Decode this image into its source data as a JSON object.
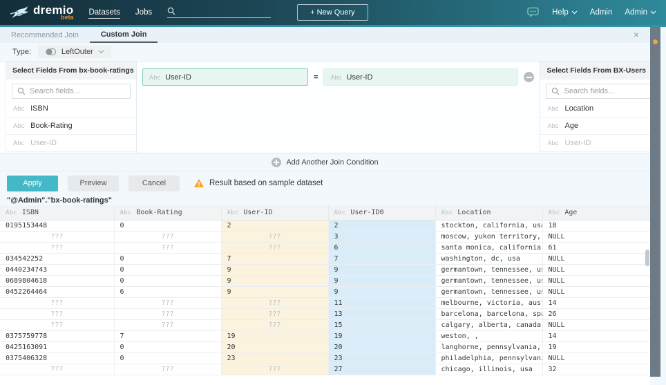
{
  "navbar": {
    "logo_text": "dremio",
    "beta_label": "beta",
    "nav_items": [
      {
        "label": "Datasets",
        "active": true
      },
      {
        "label": "Jobs",
        "active": false
      }
    ],
    "search_placeholder": "",
    "new_query_label": "+ New Query",
    "help_label": "Help",
    "admin_label": "Admin",
    "admin_menu_label": "Admin"
  },
  "tabs": [
    {
      "label": "Recommended Join",
      "active": false
    },
    {
      "label": "Custom Join",
      "active": true
    }
  ],
  "join": {
    "type_label": "Type:",
    "type_value": "LeftOuter",
    "left_panel": {
      "title": "Select Fields From bx-book-ratings (Current)",
      "search_placeholder": "Search fields...",
      "fields": [
        {
          "type": "Abc",
          "name": "ISBN",
          "disabled": false
        },
        {
          "type": "Abc",
          "name": "Book-Rating",
          "disabled": false
        },
        {
          "type": "Abc",
          "name": "User-ID",
          "disabled": true
        }
      ]
    },
    "right_panel": {
      "title": "Select Fields From BX-Users",
      "search_placeholder": "Search fields...",
      "fields": [
        {
          "type": "Abc",
          "name": "Location",
          "disabled": false
        },
        {
          "type": "Abc",
          "name": "Age",
          "disabled": false
        },
        {
          "type": "Abc",
          "name": "User-ID",
          "disabled": true
        }
      ]
    },
    "condition": {
      "left_type": "Abc",
      "left_field": "User-ID",
      "operator": "=",
      "right_type": "Abc",
      "right_field": "User-ID"
    },
    "add_condition_label": "Add Another Join Condition"
  },
  "actions": {
    "apply_label": "Apply",
    "preview_label": "Preview",
    "cancel_label": "Cancel",
    "warning_text": "Result based on sample dataset"
  },
  "table": {
    "title": "\"@Admin\".\"bx-book-ratings\"",
    "unknown_marker": "???",
    "columns": [
      {
        "type": "Abc",
        "name": "ISBN"
      },
      {
        "type": "Abc",
        "name": "Book-Rating"
      },
      {
        "type": "Abc",
        "name": "User-ID"
      },
      {
        "type": "Abc",
        "name": "User-ID0"
      },
      {
        "type": "Abc",
        "name": "Location"
      },
      {
        "type": "Abc",
        "name": "Age"
      }
    ],
    "rows": [
      [
        "0195153448",
        "0",
        "2",
        "2",
        "stockton, california, usa",
        "18"
      ],
      [
        "???",
        "???",
        "???",
        "3",
        "moscow, yukon territory, russia",
        "NULL"
      ],
      [
        "???",
        "???",
        "???",
        "6",
        "santa monica, california, usa",
        "61"
      ],
      [
        "034542252",
        "0",
        "7",
        "7",
        "washington, dc, usa",
        "NULL"
      ],
      [
        "0440234743",
        "0",
        "9",
        "9",
        "germantown, tennessee, usa",
        "NULL"
      ],
      [
        "0689804618",
        "0",
        "9",
        "9",
        "germantown, tennessee, usa",
        "NULL"
      ],
      [
        "0452264464",
        "6",
        "9",
        "9",
        "germantown, tennessee, usa",
        "NULL"
      ],
      [
        "???",
        "???",
        "???",
        "11",
        "melbourne, victoria, australia",
        "14"
      ],
      [
        "???",
        "???",
        "???",
        "13",
        "barcelona, barcelona, spain",
        "26"
      ],
      [
        "???",
        "???",
        "???",
        "15",
        "calgary, alberta, canada",
        "NULL"
      ],
      [
        "0375759778",
        "7",
        "19",
        "19",
        "weston, ,",
        "14"
      ],
      [
        "0425163091",
        "0",
        "20",
        "20",
        "langhorne, pennsylvania, usa",
        "19"
      ],
      [
        "0375406328",
        "0",
        "23",
        "23",
        "philadelphia, pennsylvania, usa",
        "NULL"
      ],
      [
        "???",
        "???",
        "???",
        "27",
        "chicago, illinois, usa",
        "32"
      ]
    ]
  },
  "colors": {
    "accent_teal": "#45b8c7",
    "brand_orange": "#e8922e",
    "navbar_dark": "#142e3b",
    "navbar_teal": "#2f8a9b",
    "chip_bg": "#e7f6f1",
    "chip_border": "#7fcfbe",
    "highlight_left_col": "#fbf3de",
    "highlight_right_col": "#d9ecf8",
    "warning_orange": "#f5a623",
    "rail_gray": "#6c7b86",
    "rail_dot_orange": "#f2a43c"
  }
}
